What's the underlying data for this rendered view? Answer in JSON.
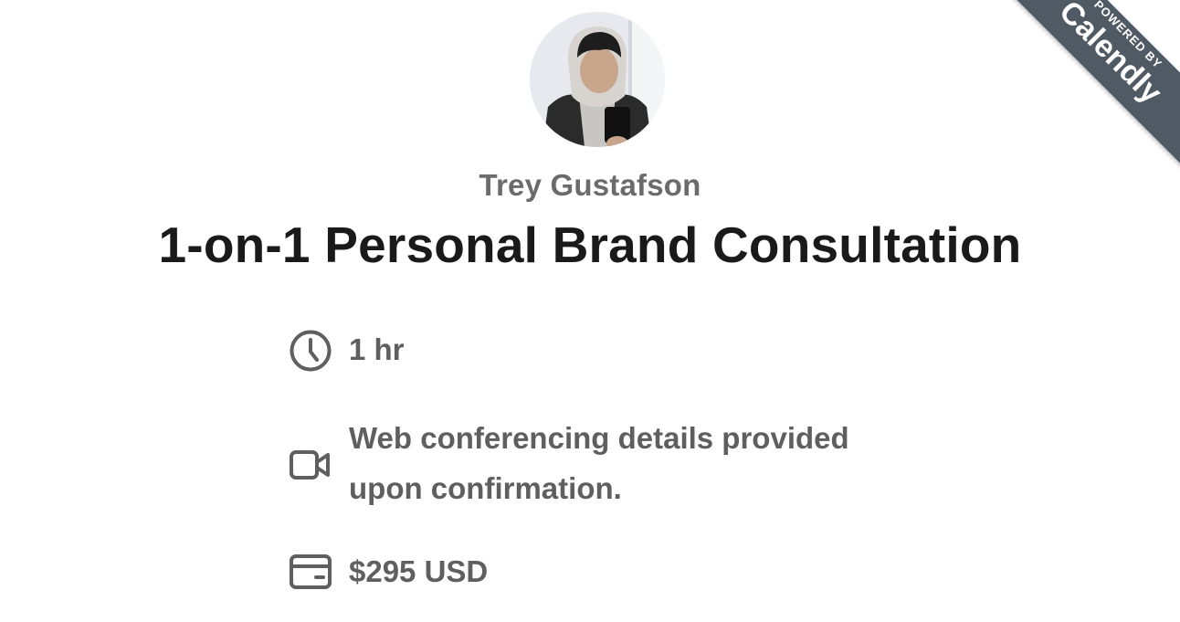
{
  "host": {
    "name": "Trey Gustafson"
  },
  "event": {
    "title": "1-on-1 Personal Brand Consultation",
    "duration": "1 hr",
    "location": "Web conferencing details provided upon confirmation.",
    "price": "$295 USD"
  },
  "badge": {
    "prefix": "POWERED BY",
    "brand": "Calendly"
  },
  "icons": {
    "duration": "clock-icon",
    "location": "video-camera-icon",
    "price": "credit-card-icon"
  },
  "colors": {
    "title": "#1a1a1a",
    "detail_text": "#5f5f5f",
    "host_name": "#6b6b6b",
    "badge_background": "#505a64"
  }
}
